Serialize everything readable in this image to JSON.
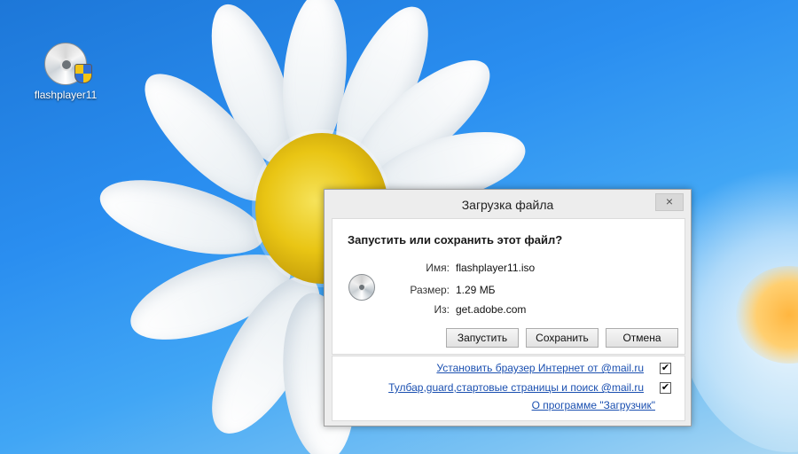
{
  "desktop": {
    "icon_label": "flashplayer11"
  },
  "dialog": {
    "title": "Загрузка файла",
    "close_glyph": "×",
    "question": "Запустить или сохранить этот файл?",
    "fields": [
      {
        "label": "Имя:",
        "value": "flashplayer11.iso"
      },
      {
        "label": "Размер:",
        "value": "1.29 МБ"
      },
      {
        "label": "Из:",
        "value": "get.adobe.com"
      }
    ],
    "buttons": {
      "run": "Запустить",
      "save": "Сохранить",
      "cancel": "Отмена"
    },
    "options": [
      {
        "label": "Установить браузер Интернет от @mail.ru",
        "checked": true,
        "check_glyph": "✔"
      },
      {
        "label": "Тулбар,guard,стартовые страницы и поиск @mail.ru",
        "checked": true,
        "check_glyph": "✔"
      }
    ],
    "about_link": "О программе \"Загрузчик\""
  },
  "colors": {
    "link": "#1a4fb0",
    "desktop_bg": "#2a8ef0"
  },
  "icons": {
    "desktop_icon": "disc-with-shield-icon",
    "file_icon": "disc-icon"
  }
}
